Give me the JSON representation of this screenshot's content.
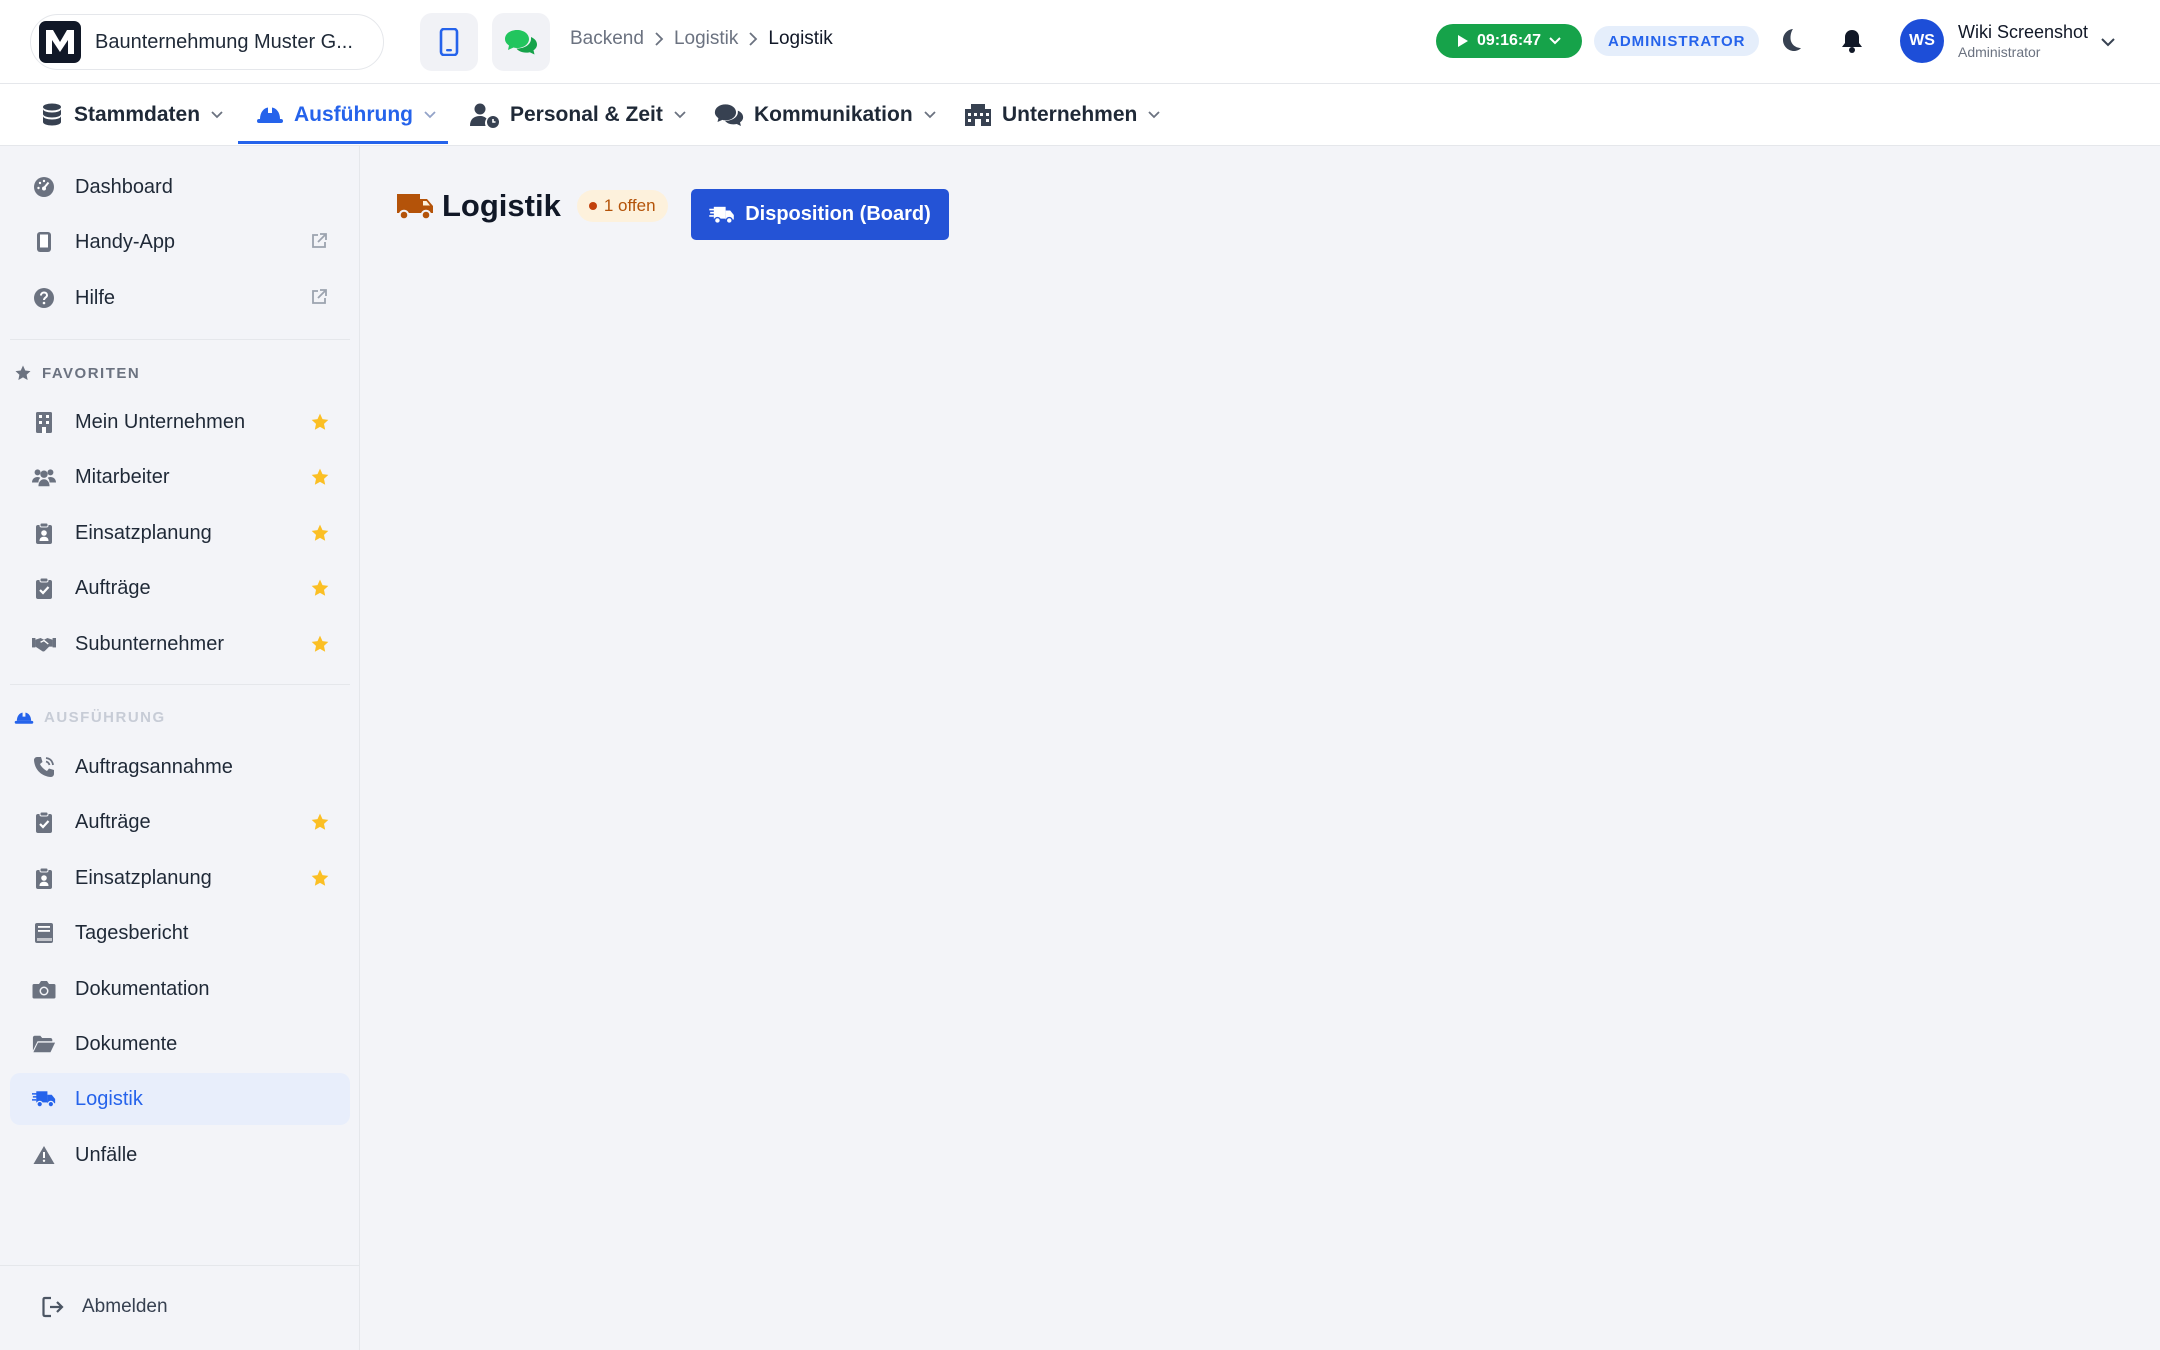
{
  "header": {
    "company_name": "Baunternehmung Muster G...",
    "logo_letter": "M",
    "breadcrumb": [
      "Backend",
      "Logistik",
      "Logistik"
    ],
    "timer": "09:16:47",
    "role_badge": "ADMINISTRATOR",
    "user": {
      "initials": "WS",
      "name": "Wiki Screenshot",
      "role": "Administrator"
    }
  },
  "modules": [
    {
      "label": "Stammdaten",
      "icon": "database-icon",
      "active": false
    },
    {
      "label": "Ausführung",
      "icon": "hardhat-icon",
      "active": true
    },
    {
      "label": "Personal & Zeit",
      "icon": "user-clock-icon",
      "active": false
    },
    {
      "label": "Kommunikation",
      "icon": "comments-icon",
      "active": false
    },
    {
      "label": "Unternehmen",
      "icon": "building-icon",
      "active": false
    }
  ],
  "sidebar": {
    "top": [
      {
        "label": "Dashboard",
        "icon": "gauge-icon"
      },
      {
        "label": "Handy-App",
        "icon": "mobile-icon",
        "external": true
      },
      {
        "label": "Hilfe",
        "icon": "question-icon",
        "external": true
      }
    ],
    "favorites_title": "FAVORITEN",
    "favorites": [
      {
        "label": "Mein Unternehmen",
        "icon": "building-icon"
      },
      {
        "label": "Mitarbeiter",
        "icon": "users-icon"
      },
      {
        "label": "Einsatzplanung",
        "icon": "clipboard-user-icon"
      },
      {
        "label": "Aufträge",
        "icon": "clipboard-check-icon"
      },
      {
        "label": "Subunternehmer",
        "icon": "handshake-icon"
      }
    ],
    "section_title": "AUSFÜHRUNG",
    "section": [
      {
        "label": "Auftragsannahme",
        "icon": "phone-icon",
        "star": false
      },
      {
        "label": "Aufträge",
        "icon": "clipboard-check-icon",
        "star": true
      },
      {
        "label": "Einsatzplanung",
        "icon": "clipboard-user-icon",
        "star": true
      },
      {
        "label": "Tagesbericht",
        "icon": "book-icon",
        "star": false
      },
      {
        "label": "Dokumentation",
        "icon": "camera-icon",
        "star": false
      },
      {
        "label": "Dokumente",
        "icon": "folder-open-icon",
        "star": false
      },
      {
        "label": "Logistik",
        "icon": "truck-fast-icon",
        "star": false,
        "active": true
      },
      {
        "label": "Unfälle",
        "icon": "warning-icon",
        "star": false
      }
    ],
    "logout": "Abmelden"
  },
  "main": {
    "title": "Logistik",
    "badge": "1 offen",
    "button": "Disposition (Board)"
  },
  "colors": {
    "accent": "#2563eb",
    "success": "#16a34a",
    "star": "#fbbf24",
    "truck": "#b45309"
  }
}
